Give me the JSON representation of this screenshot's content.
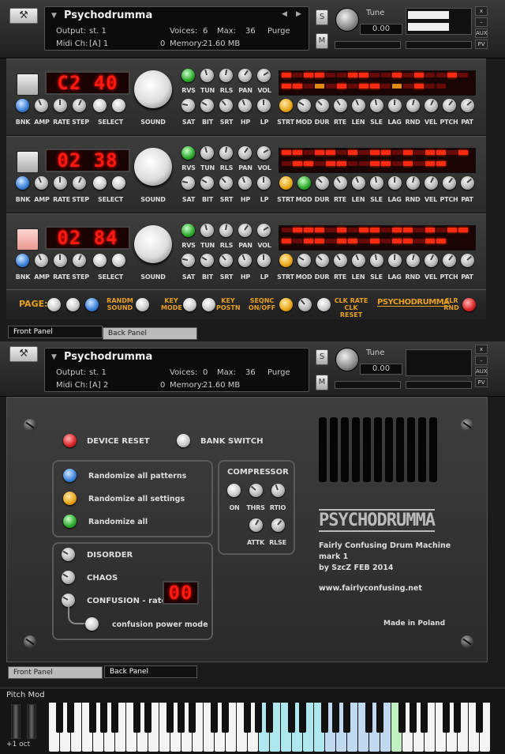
{
  "instrument_top": {
    "name": "Psychodrumma",
    "output_label": "Output:",
    "output_value": "st. 1",
    "voices_label": "Voices:",
    "voices_value": "6",
    "max_label": "Max:",
    "max_value": "36",
    "purge": "Purge",
    "midi_label": "Midi Ch:",
    "midi_value": "[A] 1",
    "memory_label": "Memory:",
    "memory_value": "21.60 MB",
    "tune_label": "Tune",
    "tune_value": "0.00",
    "mem_count": "0"
  },
  "instrument_bottom": {
    "name": "Psychodrumma",
    "output_label": "Output:",
    "output_value": "st. 1",
    "voices_label": "Voices:",
    "voices_value": "0",
    "max_label": "Max:",
    "max_value": "36",
    "purge": "Purge",
    "midi_label": "Midi Ch:",
    "midi_value": "[A] 2",
    "memory_label": "Memory:",
    "memory_value": "21.60 MB",
    "tune_label": "Tune",
    "tune_value": "0.00",
    "mem_count": "0"
  },
  "side": {
    "s": "S",
    "m": "M",
    "x": "x",
    "min": "–",
    "aux": "AUX",
    "pv": "PV",
    "l": "L",
    "r": "R"
  },
  "ch1": {
    "display": "C2 40"
  },
  "ch2": {
    "display": "02 38"
  },
  "ch3": {
    "display": "02 84"
  },
  "row_labels": {
    "bnk": "BNK",
    "amp": "AMP",
    "rate": "RATE",
    "step": "STEP",
    "select": "SELECT",
    "sound": "SOUND",
    "rvs": "RVS",
    "tun": "TUN",
    "rls": "RLS",
    "pan": "PAN",
    "vol": "VOL",
    "sat": "SAT",
    "bit": "BIT",
    "srt": "SRT",
    "hp": "HP",
    "lp": "LP",
    "strt": "STRT",
    "mod": "MOD",
    "dur": "DUR",
    "rte": "RTE",
    "len": "LEN",
    "sle": "SLE",
    "lag": "LAG",
    "rnd": "RND",
    "vel": "VEL",
    "ptch": "PTCH",
    "pat": "PAT"
  },
  "page_bar": {
    "page": "PAGE:",
    "randm": "RANDM",
    "sound": "SOUND",
    "key": "KEY",
    "mode": "MODE",
    "postn": "POSTN",
    "seqnc": "SEQNC",
    "onoff": "ON/OFF",
    "clkrate": "CLK RATE",
    "clkreset": "CLK RESET",
    "logo": "PSYCHODRUMMA",
    "clr": "CLR",
    "rnd": "RND"
  },
  "tabs": {
    "front": "Front Panel",
    "back": "Back Panel"
  },
  "back_panel": {
    "device_reset": "DEVICE RESET",
    "bank_switch": "BANK SWITCH",
    "rand_patterns": "Randomize all patterns",
    "rand_settings": "Randomize all settings",
    "rand_all": "Randomize all",
    "compressor": "COMPRESSOR",
    "on": "ON",
    "thrs": "THRS",
    "rtio": "RTIO",
    "attk": "ATTK",
    "rlse": "RLSE",
    "disorder": "DISORDER",
    "chaos": "CHAOS",
    "confusion": "CONFUSION - rate:",
    "confusion_value": "00",
    "power_mode": "confusion power mode",
    "logo": "PSYCHODRUMMA",
    "desc1": "Fairly Confusing Drum Machine",
    "desc2": "mark 1",
    "desc3": "by SzcZ  FEB 2014",
    "url": "www.fairlyconfusing.net",
    "made": "Made in Poland"
  },
  "keyboard": {
    "pitch_mod": "Pitch Mod",
    "octave": "+1 oct"
  },
  "colors": {
    "led_red": "#ff1b10",
    "orange_label": "#e8a020"
  }
}
